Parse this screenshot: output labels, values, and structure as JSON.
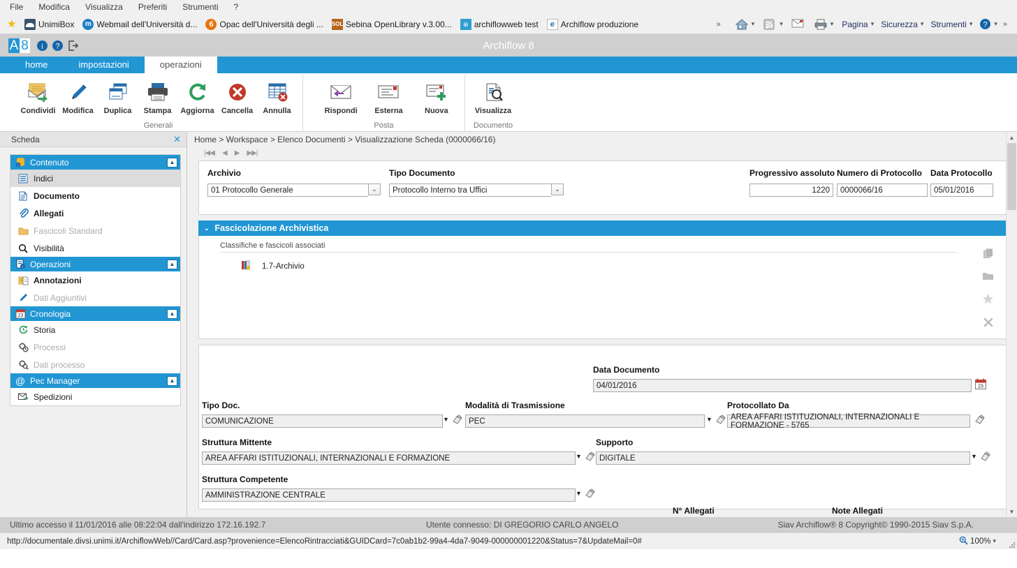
{
  "browser": {
    "menu": [
      "File",
      "Modifica",
      "Visualizza",
      "Preferiti",
      "Strumenti",
      "?"
    ],
    "favorites": [
      {
        "label": "UnimiBox",
        "icon": "unimibox-icon"
      },
      {
        "label": "Webmail dell'Università d...",
        "icon": "webmail-icon"
      },
      {
        "label": "Opac dell'Università degli ...",
        "icon": "opac-icon"
      },
      {
        "label": "Sebina OpenLibrary v.3.00...",
        "icon": "sebina-icon"
      },
      {
        "label": "archiflowweb test",
        "icon": "archiflowweb-icon"
      },
      {
        "label": "Archiflow produzione",
        "icon": "internet-explorer-icon"
      }
    ],
    "commandbar": {
      "overflow": "»",
      "home_icon": "home-icon",
      "feeds_icon": "rss-icon",
      "mail_icon": "mail-icon",
      "print_icon": "printer-icon",
      "page_label": "Pagina",
      "security_label": "Sicurezza",
      "tools_label": "Strumenti",
      "help_icon": "help-icon",
      "tail_overflow": "»"
    },
    "status_url": "http://documentale.divsi.unimi.it/ArchiflowWeb//Card/Card.asp?provenience=ElencoRintracciati&GUIDCard=7c0ab1b2-99a4-4da7-9049-000000001220&Status=7&UpdateMail=0#",
    "zoom_level": "100%"
  },
  "app": {
    "logo": {
      "a": "A",
      "eight": "8"
    },
    "header_icons": [
      "info-icon",
      "help-icon",
      "logout-icon"
    ],
    "title": "Archiflow 8",
    "tabs": [
      {
        "label": "home",
        "active": false
      },
      {
        "label": "impostazioni",
        "active": false
      },
      {
        "label": "operazioni",
        "active": true
      }
    ]
  },
  "ribbon": {
    "groups": [
      {
        "title": "Generali",
        "buttons": [
          {
            "label": "Condividi",
            "icon": "share-mail-icon"
          },
          {
            "label": "Modifica",
            "icon": "pencil-icon"
          },
          {
            "label": "Duplica",
            "icon": "duplicate-icon"
          },
          {
            "label": "Stampa",
            "icon": "printer-icon"
          },
          {
            "label": "Aggiorna",
            "icon": "refresh-icon"
          },
          {
            "label": "Cancella",
            "icon": "delete-icon"
          },
          {
            "label": "Annulla",
            "icon": "cancel-grid-icon"
          }
        ]
      },
      {
        "title": "Posta",
        "buttons": [
          {
            "label": "Rispondi",
            "icon": "reply-icon"
          },
          {
            "label": "Esterna",
            "icon": "external-mail-icon"
          },
          {
            "label": "Nuova",
            "icon": "new-mail-icon"
          }
        ]
      },
      {
        "title": "Documento",
        "buttons": [
          {
            "label": "Visualizza",
            "icon": "view-document-icon"
          }
        ]
      }
    ]
  },
  "sidebar": {
    "panel_title": "Scheda",
    "close_icon": "close-icon",
    "groups": [
      {
        "label": "Contenuto",
        "icon": "content-icon",
        "collapse_icon": "chevron-up-icon",
        "items": [
          {
            "label": "Indici",
            "icon": "index-icon",
            "state": "selected"
          },
          {
            "label": "Documento",
            "icon": "document-icon",
            "state": "bold"
          },
          {
            "label": "Allegati",
            "icon": "paperclip-icon",
            "state": "bold"
          },
          {
            "label": "Fascicoli Standard",
            "icon": "folder-icon",
            "state": "disabled"
          },
          {
            "label": "Visibilità",
            "icon": "search-icon",
            "state": "normal"
          }
        ]
      },
      {
        "label": "Operazioni",
        "icon": "operations-icon",
        "collapse_icon": "chevron-up-icon",
        "items": [
          {
            "label": "Annotazioni",
            "icon": "notes-icon",
            "state": "bold"
          },
          {
            "label": "Dati Aggiuntivi",
            "icon": "pencil-icon",
            "state": "disabled"
          }
        ]
      },
      {
        "label": "Cronologia",
        "icon": "calendar-icon",
        "collapse_icon": "chevron-up-icon",
        "items": [
          {
            "label": "Storia",
            "icon": "history-icon",
            "state": "normal"
          },
          {
            "label": "Processi",
            "icon": "process-icon",
            "state": "disabled"
          },
          {
            "label": "Dati processo",
            "icon": "process-data-icon",
            "state": "disabled"
          }
        ]
      },
      {
        "label": "Pec Manager",
        "icon": "at-icon",
        "collapse_icon": "chevron-up-icon",
        "items": [
          {
            "label": "Spedizioni",
            "icon": "send-mail-icon",
            "state": "normal"
          }
        ]
      }
    ]
  },
  "main": {
    "breadcrumb": "Home > Workspace > Elenco Documenti > Visualizzazione Scheda (0000066/16)",
    "pager": {
      "first": "|◀◀",
      "prev": "◀",
      "next": "▶",
      "last": "▶▶|"
    },
    "top_fields": [
      {
        "label": "Archivio",
        "value": "01 Protocollo Generale",
        "type": "select"
      },
      {
        "label": "Tipo Documento",
        "value": "Protocollo Interno tra Uffici",
        "type": "select"
      }
    ],
    "right_fields": [
      {
        "label": "Progressivo assoluto",
        "value": "1220",
        "align": "right"
      },
      {
        "label": "Numero di Protocollo",
        "value": "0000066/16",
        "align": "left"
      },
      {
        "label": "Data Protocollo",
        "value": "05/01/2016",
        "align": "left"
      }
    ],
    "fascicolazione": {
      "title": "Fascicolazione Archivistica",
      "toggle_icon": "chevron-down-icon",
      "subtitle": "Classifiche e fascicoli associati",
      "rows": [
        {
          "icon": "classification-icon",
          "label": "1.7-Archivio"
        }
      ],
      "tools": [
        {
          "icon": "copy-icon"
        },
        {
          "icon": "folder-icon"
        },
        {
          "icon": "star-icon"
        },
        {
          "icon": "close-x-icon"
        }
      ]
    },
    "data_documento": {
      "label": "Data Documento",
      "value": "04/01/2016",
      "calendar_icon": "calendar-icon"
    },
    "fields": [
      {
        "label": "Tipo Doc.",
        "value": "COMUNICAZIONE",
        "dropdown": true,
        "eraser": true
      },
      {
        "label": "Modalità di Trasmissione",
        "value": "PEC",
        "dropdown": true,
        "eraser": true
      },
      {
        "label": "Protocollato Da",
        "value": "AREA AFFARI ISTITUZIONALI, INTERNAZIONALI E FORMAZIONE - 5765",
        "dropdown": false,
        "eraser": true
      },
      {
        "label": "Struttura Mittente",
        "value": "AREA AFFARI ISTITUZIONALI, INTERNAZIONALI E FORMAZIONE",
        "dropdown": true,
        "eraser": true
      },
      {
        "label": "Supporto",
        "value": "DIGITALE",
        "dropdown": true,
        "eraser": true
      },
      {
        "label": "Struttura Competente",
        "value": "AMMINISTRAZIONE CENTRALE",
        "dropdown": true,
        "eraser": true
      }
    ],
    "bottom_labels": [
      {
        "label": "N° Allegati"
      },
      {
        "label": "Note Allegati"
      }
    ]
  },
  "footer": {
    "last_access": "Ultimo accesso il 11/01/2016 alle 08:22:04 dall'indirizzo 172.16.192.7",
    "connected_user": "Utente connesso: DI GREGORIO CARLO ANGELO",
    "copyright": "Siav Archiflow® 8 Copyright© 1990-2015 Siav S.p.A."
  },
  "colors": {
    "accent": "#2196d3",
    "header_gray": "#cfcfcf",
    "panel_bg": "#f0f0f0"
  }
}
